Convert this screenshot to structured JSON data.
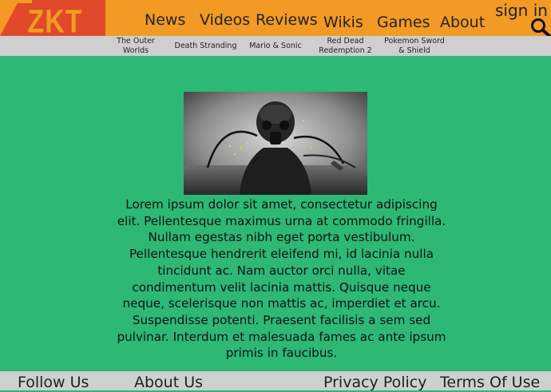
{
  "logo": {
    "text": "ZKT"
  },
  "nav": {
    "items": [
      "News",
      "Videos",
      "Reviews",
      "Wikis",
      "Games",
      "About"
    ],
    "signin": "sign in"
  },
  "subnav": {
    "items": [
      "The Outer Worlds",
      "Death Stranding",
      "Mario & Sonic",
      "Red Dead Redemption 2",
      "Pokemon Sword & Shield"
    ]
  },
  "article": {
    "body": "Lorem ipsum dolor sit amet, consectetur adipiscing elit. Pellentesque maximus urna at commodo fringilla. Nullam egestas nibh eget porta vestibulum. Pellentesque hendrerit eleifend mi, id lacinia nulla tincidunt ac. Nam auctor orci nulla, vitae condimentum velit lacinia mattis. Quisque neque neque, scelerisque non mattis ac, imperdiet et arcu. Suspendisse potenti. Praesent facilisis a sem sed pulvinar. Interdum et malesuada fames ac ante ipsum primis in faucibus."
  },
  "footer": {
    "follow": "Follow Us",
    "about": "About Us",
    "privacy": "Privacy Policy",
    "terms": "Terms Of Use"
  },
  "colors": {
    "header": "#f29a24",
    "logo_bg": "#e04a2a",
    "background": "#2db876",
    "bars": "#cfcfcf"
  },
  "icons": {
    "search": "search-icon"
  }
}
